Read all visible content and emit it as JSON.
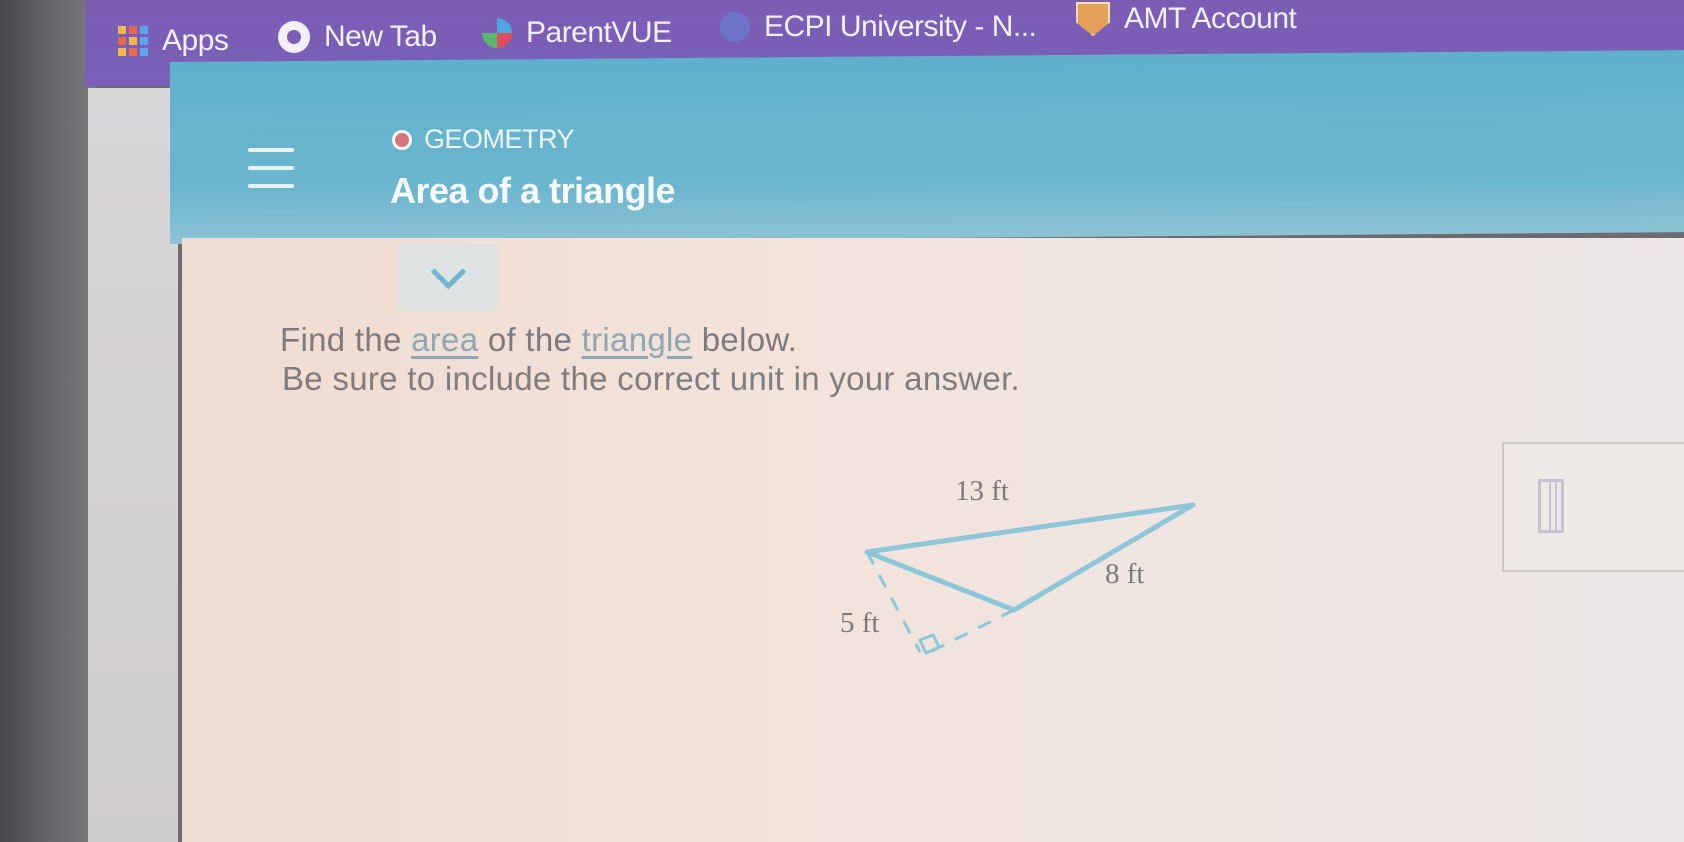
{
  "bookmarks": [
    {
      "label": "Apps",
      "icon": "apps-grid-icon"
    },
    {
      "label": "New Tab",
      "icon": "new-tab-icon"
    },
    {
      "label": "ParentVUE",
      "icon": "parentvue-icon"
    },
    {
      "label": "ECPI University - N...",
      "icon": "ecpi-icon"
    },
    {
      "label": "AMT Account",
      "icon": "amt-shield-icon"
    }
  ],
  "header": {
    "subject": "GEOMETRY",
    "title": "Area of a triangle"
  },
  "question": {
    "line1_prefix": "Find the ",
    "link1": "area",
    "line1_mid": " of the ",
    "link2": "triangle",
    "line1_suffix": " below.",
    "line2": "Be sure to include the correct unit in your answer."
  },
  "figure": {
    "label_top": "13 ft",
    "label_right": "8 ft",
    "label_height": "5 ft"
  },
  "colors": {
    "bookmark_bar": "#7b5db4",
    "header": "#5fb0cc",
    "triangle_stroke": "#8cc3d6"
  }
}
